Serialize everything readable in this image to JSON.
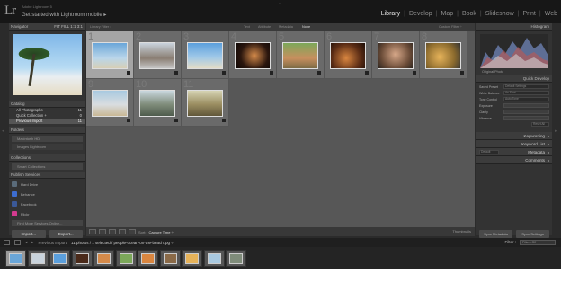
{
  "window": {
    "small_title": "Adobe Lightroom 5",
    "subtitle": "Get started with Lightroom mobile",
    "subtitle_arrow": "▸",
    "logo": "Lr",
    "top_arrow": "▲",
    "side_arrow_left": "◂",
    "side_arrow_right": "▸"
  },
  "modules": [
    {
      "label": "Library",
      "active": true
    },
    {
      "label": "Develop"
    },
    {
      "label": "Map"
    },
    {
      "label": "Book"
    },
    {
      "label": "Slideshow"
    },
    {
      "label": "Print"
    },
    {
      "label": "Web"
    }
  ],
  "module_sep": "|",
  "navigator": {
    "title": "Navigator",
    "options": "FIT FILL 1:1 3:1"
  },
  "catalog": {
    "title": "Catalog",
    "items": [
      {
        "label": "All Photographs",
        "count": "11"
      },
      {
        "label": "Quick Collection +",
        "count": "0"
      },
      {
        "label": "Previous Import",
        "count": "11",
        "selected": true
      }
    ]
  },
  "folders": {
    "title": "Folders",
    "rows": [
      "Macintosh HD",
      "Images Lightroom"
    ]
  },
  "collections": {
    "title": "Collections",
    "rows": [
      "Smart Collections"
    ]
  },
  "publish": {
    "title": "Publish Services",
    "items": [
      {
        "label": "Hard Drive",
        "color": "#5a6b7a"
      },
      {
        "label": "Behance",
        "color": "#3d6dd0"
      },
      {
        "label": "Facebook",
        "color": "#3b5998"
      },
      {
        "label": "Flickr",
        "color": "#d33a8f"
      }
    ],
    "find_more": "Find More Services Online..."
  },
  "left_buttons": {
    "import": "Import...",
    "export": "Export..."
  },
  "filter_bar": {
    "title": "Library Filter :",
    "items": [
      "Text",
      "Attribute",
      "Metadata",
      "None"
    ],
    "active": "None",
    "custom": "Custom Filter ÷"
  },
  "grid": {
    "cells": [
      {
        "n": "1",
        "sel": true,
        "tc": "#5e9ad1",
        "bg": "linear-gradient(#6aa6d8,#bad6ea 60%,#d7cfb6)"
      },
      {
        "n": "2",
        "tc": "#d8d8d8",
        "bg": "linear-gradient(#c9d3dc,#8a7e73 60%,#c4c4c4)"
      },
      {
        "n": "3",
        "tc": "#5a9ad4",
        "bg": "linear-gradient(#5b9fdc,#9fc8e8 55%,#e2dcc7)"
      },
      {
        "n": "4",
        "tc": "#2a1a10",
        "bg": "radial-gradient(circle at 55% 50%,#d48a4a,#2b160e 60%,#0c0604)"
      },
      {
        "n": "5",
        "tc": "#6b8a4c",
        "bg": "linear-gradient(#7ca85a,#c78f5e 60%,#7d6b45)"
      },
      {
        "n": "6",
        "tc": "#3a2010",
        "bg": "radial-gradient(circle at 45% 60%,#d98640,#5a2c15 60%,#1d0d06)"
      },
      {
        "n": "7",
        "tc": "#6a5a4a",
        "bg": "radial-gradient(circle at 50% 45%,#d7a889,#6b4c38 65%,#2e2620)"
      },
      {
        "n": "8",
        "tc": "#8a6a30",
        "bg": "radial-gradient(circle at 40% 55%,#e6b35a,#8b6a2d 60%,#333)"
      },
      {
        "n": "9",
        "tc": "#8fb3cb",
        "bg": "linear-gradient(#a9c9e0,#d9dde0 55%,#c9b895)"
      },
      {
        "n": "10",
        "tc": "#6f8f9a",
        "bg": "linear-gradient(#c9d7de,#7f8c7a 55%,#4e5b4c)"
      },
      {
        "n": "11",
        "tc": "#8a8a60",
        "bg": "linear-gradient(#d5d3b3,#9a8d60 55%,#61573a)"
      }
    ]
  },
  "toolbar": {
    "sort_label": "Sort:",
    "sort_value": "Capture Time ÷",
    "thumbnails": "Thumbnails"
  },
  "histogram": {
    "title": "Histogram",
    "original_photo": "Original Photo"
  },
  "quick_develop": {
    "title": "Quick Develop",
    "rows": [
      {
        "label": "Saved Preset",
        "value": "Default Settings"
      },
      {
        "label": "White Balance",
        "value": "As Shot"
      },
      {
        "label": "Tone Control",
        "value": "Auto Tone"
      },
      {
        "label": "Exposure",
        "value": ""
      },
      {
        "label": "Clarity",
        "value": ""
      },
      {
        "label": "Vibrance",
        "value": ""
      }
    ],
    "reset": "Reset All"
  },
  "right_sections": [
    "Keywording",
    "Keyword List",
    "Metadata",
    "Comments"
  ],
  "metadata_preset": "Default",
  "right_buttons": {
    "sync_meta": "Sync Metadata",
    "sync_settings": "Sync Settings"
  },
  "strip_bar": {
    "source": "Previous Import",
    "info": "11 photos / 1 selected / people-ocean-on-the-beach.jpg ÷",
    "filter_label": "Filter :",
    "filter_value": "Filters Off"
  },
  "filmstrip": [
    {
      "sel": true,
      "tc": "#6aa6d8"
    },
    {
      "tc": "#c9d3dc"
    },
    {
      "tc": "#5b9fdc"
    },
    {
      "tc": "#4a2a1a"
    },
    {
      "tc": "#d48a4a"
    },
    {
      "tc": "#7ca85a"
    },
    {
      "tc": "#d98640"
    },
    {
      "tc": "#8a6a48"
    },
    {
      "tc": "#e6b35a"
    },
    {
      "tc": "#a9c9e0"
    },
    {
      "tc": "#7f8c7a"
    }
  ]
}
